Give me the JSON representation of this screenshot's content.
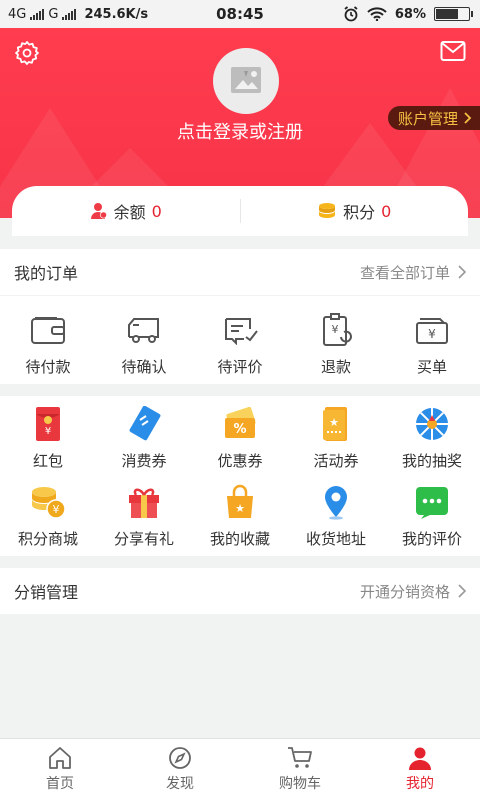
{
  "status_bar": {
    "net1": "4G",
    "net2": "G",
    "speed": "245.6K/s",
    "time": "08:45",
    "battery": "68%",
    "battery_level": 0.68
  },
  "header": {
    "login_prompt": "点击登录或注册",
    "account_manage": "账户管理"
  },
  "balance": {
    "balance_label": "余额",
    "balance_value": "0",
    "points_label": "积分",
    "points_value": "0"
  },
  "orders": {
    "title": "我的订单",
    "view_all": "查看全部订单",
    "items": [
      {
        "label": "待付款",
        "icon": "wallet-icon"
      },
      {
        "label": "待确认",
        "icon": "truck-icon"
      },
      {
        "label": "待评价",
        "icon": "review-icon"
      },
      {
        "label": "退款",
        "icon": "refund-icon"
      },
      {
        "label": "买单",
        "icon": "pay-bill-icon"
      }
    ]
  },
  "services": {
    "row1": [
      {
        "label": "红包",
        "icon": "red-envelope-icon"
      },
      {
        "label": "消费券",
        "icon": "voucher-icon"
      },
      {
        "label": "优惠券",
        "icon": "coupon-icon"
      },
      {
        "label": "活动券",
        "icon": "event-ticket-icon"
      },
      {
        "label": "我的抽奖",
        "icon": "lottery-wheel-icon"
      }
    ],
    "row2": [
      {
        "label": "积分商城",
        "icon": "coin-stack-icon"
      },
      {
        "label": "分享有礼",
        "icon": "gift-icon"
      },
      {
        "label": "我的收藏",
        "icon": "favorites-bag-icon"
      },
      {
        "label": "收货地址",
        "icon": "location-pin-icon"
      },
      {
        "label": "我的评价",
        "icon": "chat-bubble-icon"
      }
    ]
  },
  "distribution": {
    "title": "分销管理",
    "link": "开通分销资格"
  },
  "tabbar": {
    "items": [
      {
        "label": "首页",
        "icon": "home-icon"
      },
      {
        "label": "发现",
        "icon": "compass-icon"
      },
      {
        "label": "购物车",
        "icon": "cart-icon"
      },
      {
        "label": "我的",
        "icon": "user-icon"
      }
    ],
    "active": "我的"
  },
  "colors": {
    "brand_red": "#f73348",
    "value_red": "#e5232f",
    "gold": "#f6c143"
  }
}
